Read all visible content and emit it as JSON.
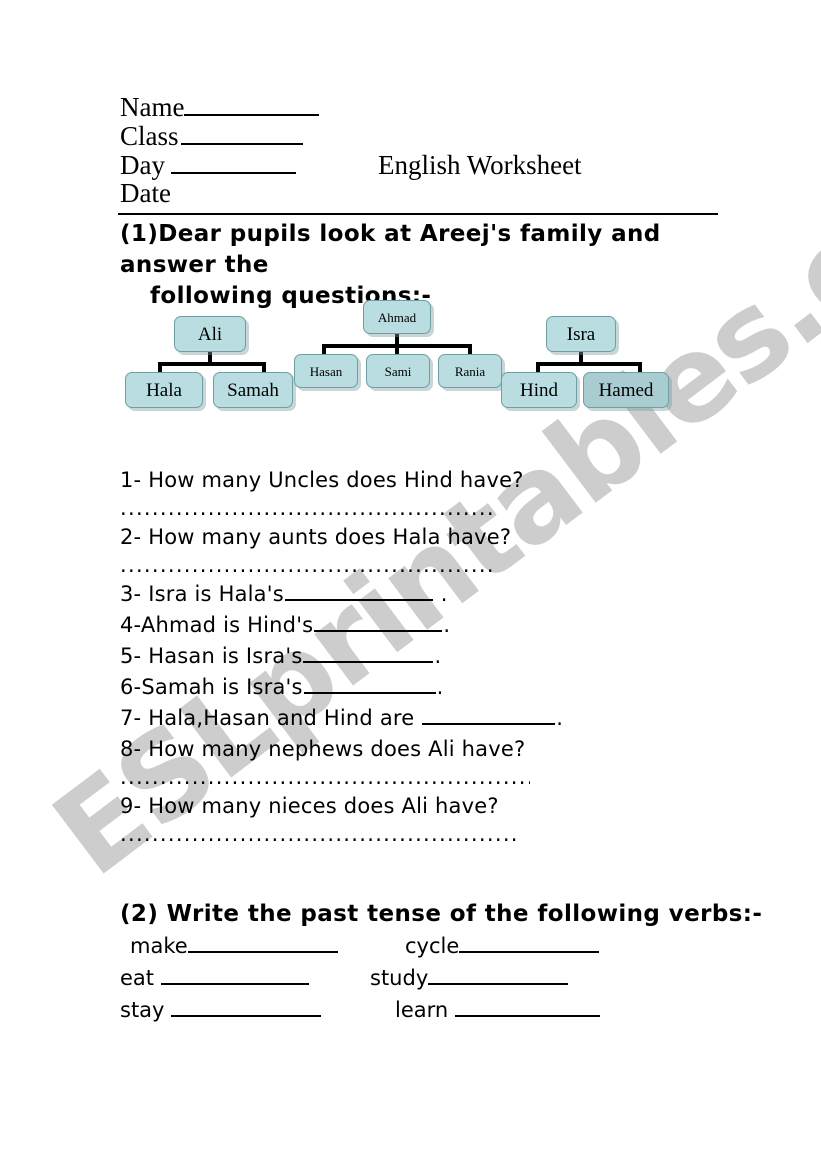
{
  "header": {
    "fields": [
      {
        "label": "Name",
        "blank_class": "w-name"
      },
      {
        "label": "Class",
        "blank_class": "w-class"
      },
      {
        "label": "Day",
        "blank_class": "w-day"
      },
      {
        "label": "Date",
        "blank_class": ""
      }
    ],
    "name_label": "Name",
    "class_label": "Class",
    "day_label": "Day",
    "date_label": "Date",
    "title": "English Worksheet"
  },
  "section1": {
    "instruction_line1": "(1)Dear pupils look at Areej's family and answer the",
    "instruction_line2": "following questions:-",
    "diagram": {
      "colors": {
        "node_fill": "#b9dde0",
        "node_fill_shaded": "#a9ccd0",
        "node_border": "#6f9fa3",
        "connector": "#000000"
      },
      "families": [
        {
          "parent": "Ali",
          "children": [
            "Hala",
            "Samah"
          ]
        },
        {
          "parent": "Ahmad",
          "children": [
            "Hasan",
            "Sami",
            "Rania"
          ]
        },
        {
          "parent": "Isra",
          "children": [
            "Hind",
            "Hamed"
          ]
        }
      ],
      "nodes": {
        "ali": "Ali",
        "hala": "Hala",
        "samah": "Samah",
        "ahmad": "Ahmad",
        "hasan": "Hasan",
        "sami": "Sami",
        "rania": "Rania",
        "isra": "Isra",
        "hind": "Hind",
        "hamed": "Hamed"
      }
    },
    "questions": [
      {
        "text": "1- How many Uncles does Hind have?",
        "answer": "dots",
        "dots_width": 372,
        "dots_period": true
      },
      {
        "text": "2- How many aunts does Hala have?",
        "answer": "dots",
        "dots_width": 372,
        "dots_period": true
      },
      {
        "text_before": "3- Isra is Hala's",
        "blank_width": 148,
        "text_after": " ."
      },
      {
        "text_before": "4-Ahmad is Hind's",
        "blank_width": 128,
        "text_after": "."
      },
      {
        "text_before": "5- Hasan is Isra's",
        "blank_width": 130,
        "text_after": "."
      },
      {
        "text_before": "6-Samah is Isra's",
        "blank_width": 132,
        "text_after": "."
      },
      {
        "text_before": "7- Hala,Hasan and Hind are ",
        "blank_width": 133,
        "text_after": "."
      },
      {
        "text": "8- How many nephews does Ali have?",
        "answer": "dots",
        "dots_width": 410,
        "dots_period": false
      },
      {
        "text": "9- How many nieces does Ali have?",
        "answer": "dots",
        "dots_width": 400,
        "dots_period": false
      }
    ],
    "q1": "1- How many Uncles does Hind have?",
    "q2": "2- How many aunts does Hala have?",
    "q3_before": "3- Isra is Hala's",
    "q3_after": " .",
    "q4_before": "4-Ahmad is Hind's",
    "q4_after": ".",
    "q5_before": "5- Hasan is Isra's",
    "q5_after": ".",
    "q6_before": "6-Samah is Isra's",
    "q6_after": ".",
    "q7_before": "7- Hala,Hasan and Hind are ",
    "q7_after": ".",
    "q8": "8- How many nephews does Ali have?",
    "q9": "9- How many nieces does Ali have?"
  },
  "section2": {
    "title": "(2) Write the past tense of the following verbs:-",
    "rows": [
      {
        "left": "make",
        "right": "cycle"
      },
      {
        "left": "eat ",
        "right": "study"
      },
      {
        "left": "stay ",
        "right": "learn "
      }
    ],
    "verb_make": "make",
    "verb_cycle": "cycle",
    "verb_eat": "eat ",
    "verb_study": "study",
    "verb_stay": "stay ",
    "verb_learn": "learn "
  },
  "watermark": {
    "text": "ESLprintables.com",
    "color": "#cdcdcd"
  }
}
